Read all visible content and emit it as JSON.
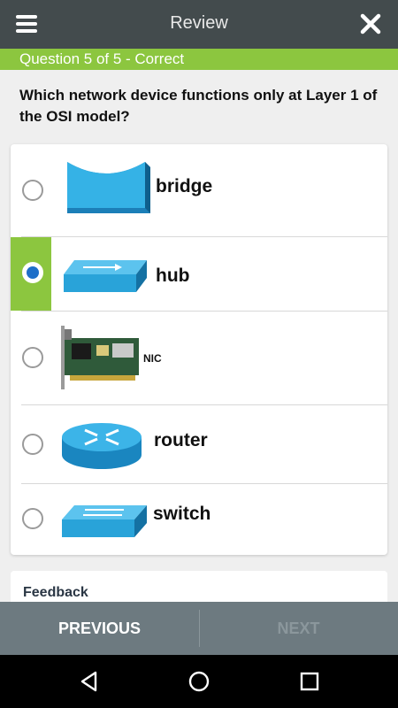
{
  "header": {
    "title": "Review",
    "menu_icon": "hamburger-menu-icon",
    "close_icon": "close-icon"
  },
  "status": {
    "text": "Question 5 of 5 - Correct",
    "color": "#8cc63f"
  },
  "question": {
    "text": "Which network device functions only at Layer 1 of the OSI model?"
  },
  "answers": [
    {
      "label": "bridge",
      "selected": false,
      "correct": false,
      "icon": "bridge-device-icon"
    },
    {
      "label": "hub",
      "selected": true,
      "correct": true,
      "icon": "hub-device-icon"
    },
    {
      "label": "NIC",
      "selected": false,
      "correct": false,
      "icon": "nic-card-icon"
    },
    {
      "label": "router",
      "selected": false,
      "correct": false,
      "icon": "router-device-icon"
    },
    {
      "label": "switch",
      "selected": false,
      "correct": false,
      "icon": "switch-device-icon"
    }
  ],
  "feedback": {
    "title": "Feedback"
  },
  "navigation": {
    "previous_label": "PREVIOUS",
    "next_label": "NEXT"
  },
  "system_nav": {
    "back_icon": "back-icon",
    "home_icon": "home-icon",
    "recents_icon": "recents-icon"
  },
  "colors": {
    "header_bg": "#434b4d",
    "correct": "#8cc63f",
    "selected_radio": "#1e6fc9",
    "device_blue": "#29a8df",
    "bottom_bar": "#6d7a80"
  }
}
